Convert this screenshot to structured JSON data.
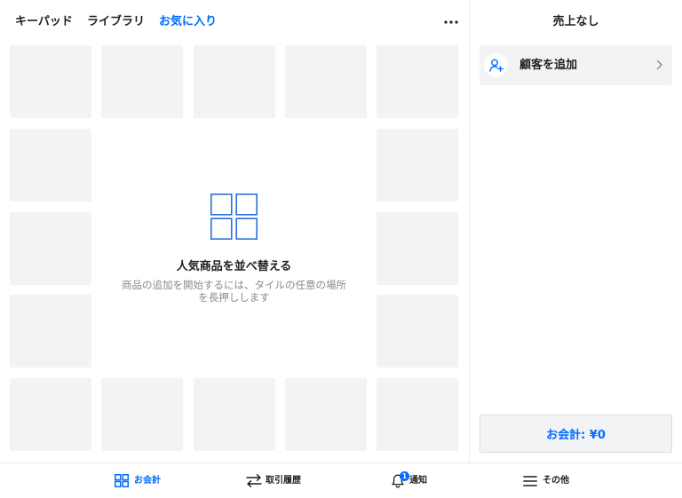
{
  "header": {
    "tabs": [
      {
        "label": "キーパッド",
        "active": false
      },
      {
        "label": "ライブラリ",
        "active": false
      },
      {
        "label": "お気に入り",
        "active": true
      }
    ],
    "more_icon": "more-horizontal-icon"
  },
  "favorites_grid": {
    "empty_state": {
      "icon": "grid-icon",
      "title": "人気商品を並べ替える",
      "description": [
        "商品の追加を開始するには、タイルの任意の場所",
        "を長押しします"
      ]
    }
  },
  "sale_panel": {
    "title": "売上なし",
    "add_customer": {
      "icon": "person-add-icon",
      "label": "顧客を追加",
      "chevron_icon": "chevron-right-icon"
    },
    "checkout_button": {
      "label": "お会計: ¥0"
    }
  },
  "bottom_nav": [
    {
      "label": "お会計",
      "icon": "grid-icon",
      "active": true
    },
    {
      "label": "取引履歴",
      "icon": "transfer-arrows-icon",
      "active": false
    },
    {
      "label": "通知",
      "icon": "bell-icon",
      "badge": "1",
      "active": false
    },
    {
      "label": "その他",
      "icon": "menu-icon",
      "active": false
    }
  ],
  "colors": {
    "accent": "#006aff",
    "tile": "#f2f3f5",
    "text": "#1f1f1f",
    "muted": "#8a8a8a",
    "divider": "#e8e8e8"
  }
}
